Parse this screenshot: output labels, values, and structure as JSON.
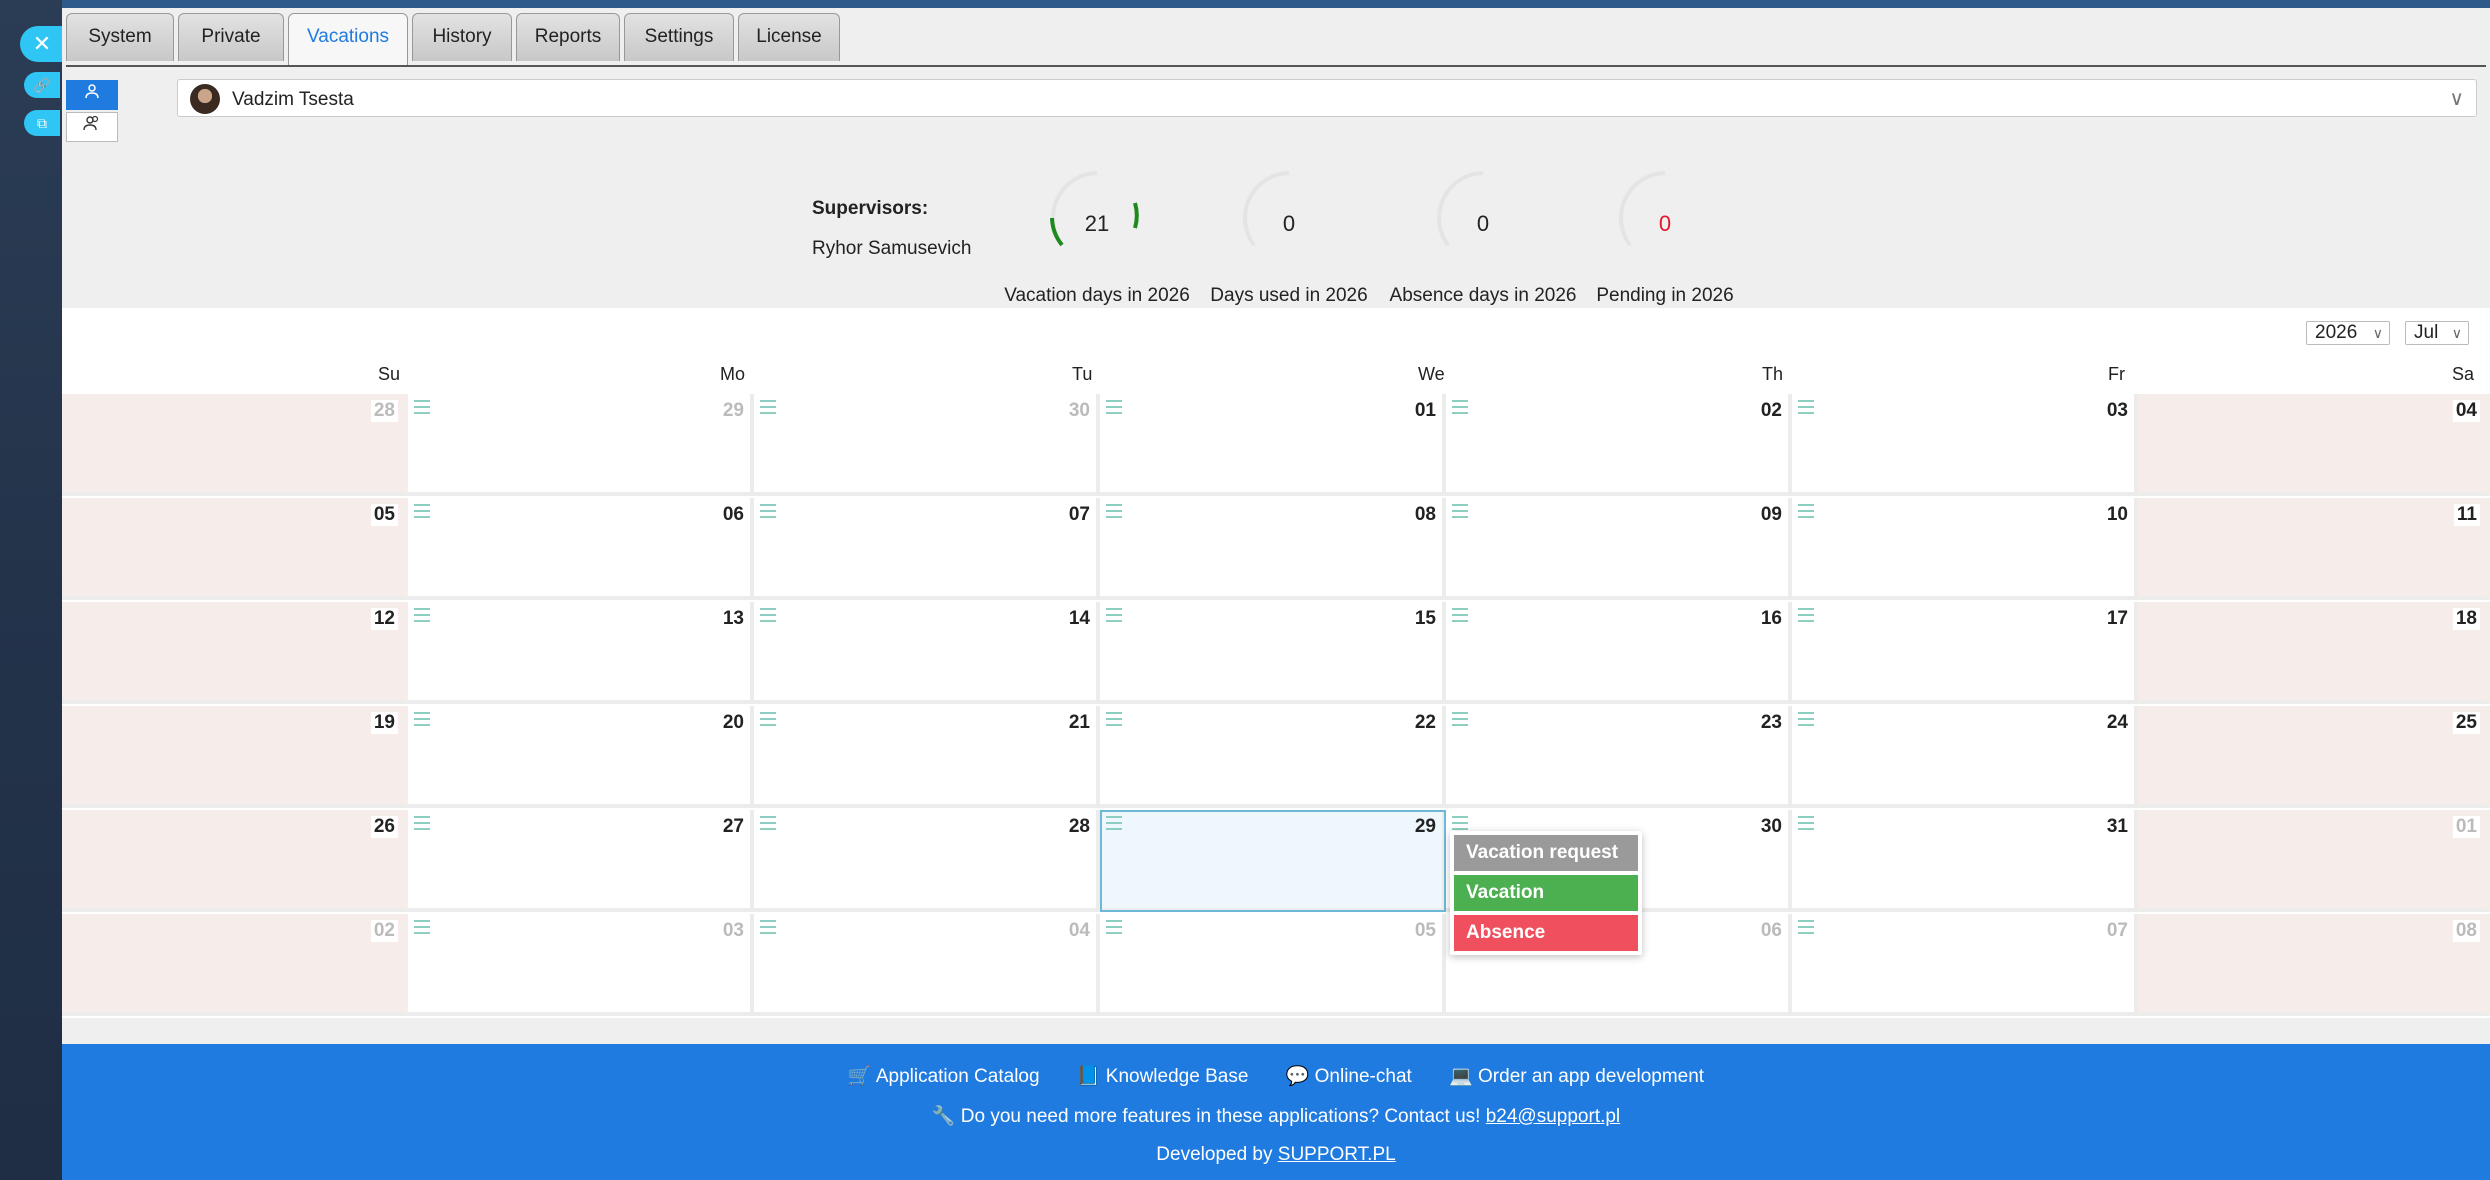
{
  "tabs": [
    {
      "label": "System"
    },
    {
      "label": "Private"
    },
    {
      "label": "Vacations"
    },
    {
      "label": "History"
    },
    {
      "label": "Reports"
    },
    {
      "label": "Settings"
    },
    {
      "label": "License"
    }
  ],
  "active_tab": "Vacations",
  "user": {
    "name": "Vadzim Tsesta"
  },
  "supervisors": {
    "title": "Supervisors:",
    "name": "Ryhor Samusevich"
  },
  "stats": [
    {
      "value": "21",
      "caption": "Vacation days in 2026",
      "fraction": 0.3
    },
    {
      "value": "0",
      "caption": "Days used in 2026",
      "fraction": 0
    },
    {
      "value": "0",
      "caption": "Absence days in 2026",
      "fraction": 0
    },
    {
      "value": "0",
      "caption": "Pending in 2026",
      "fraction": 0
    }
  ],
  "calendar": {
    "year": "2026",
    "month": "Jul",
    "weekdays": [
      "Su",
      "Mo",
      "Tu",
      "We",
      "Th",
      "Fr",
      "Sa"
    ],
    "weeks": [
      [
        "28",
        "29",
        "30",
        "01",
        "02",
        "03",
        "04"
      ],
      [
        "05",
        "06",
        "07",
        "08",
        "09",
        "10",
        "11"
      ],
      [
        "12",
        "13",
        "14",
        "15",
        "16",
        "17",
        "18"
      ],
      [
        "19",
        "20",
        "21",
        "22",
        "23",
        "24",
        "25"
      ],
      [
        "26",
        "27",
        "28",
        "29",
        "30",
        "31",
        "01"
      ],
      [
        "02",
        "03",
        "04",
        "05",
        "06",
        "07",
        "08"
      ]
    ],
    "selected_day": "29"
  },
  "context_menu": [
    {
      "label": "Vacation request",
      "color": "#9a9a9a"
    },
    {
      "label": "Vacation",
      "color": "#4caf50"
    },
    {
      "label": "Absence",
      "color": "#f0505e"
    }
  ],
  "footer": {
    "links": [
      {
        "icon": "cart-icon",
        "label": "Application Catalog"
      },
      {
        "icon": "book-icon",
        "label": "Knowledge Base"
      },
      {
        "icon": "chat-icon",
        "label": "Online-chat"
      },
      {
        "icon": "laptop-icon",
        "label": "Order an app development"
      }
    ],
    "question": "Do you need more features in these applications? Contact us!",
    "email": "b24@support.pl",
    "developed_by": "Developed by",
    "developer": "SUPPORT.PL"
  },
  "colors": {
    "accent": "#1f7be0",
    "weekend": "#f6ece9",
    "gauge": "#1e8a1e"
  }
}
